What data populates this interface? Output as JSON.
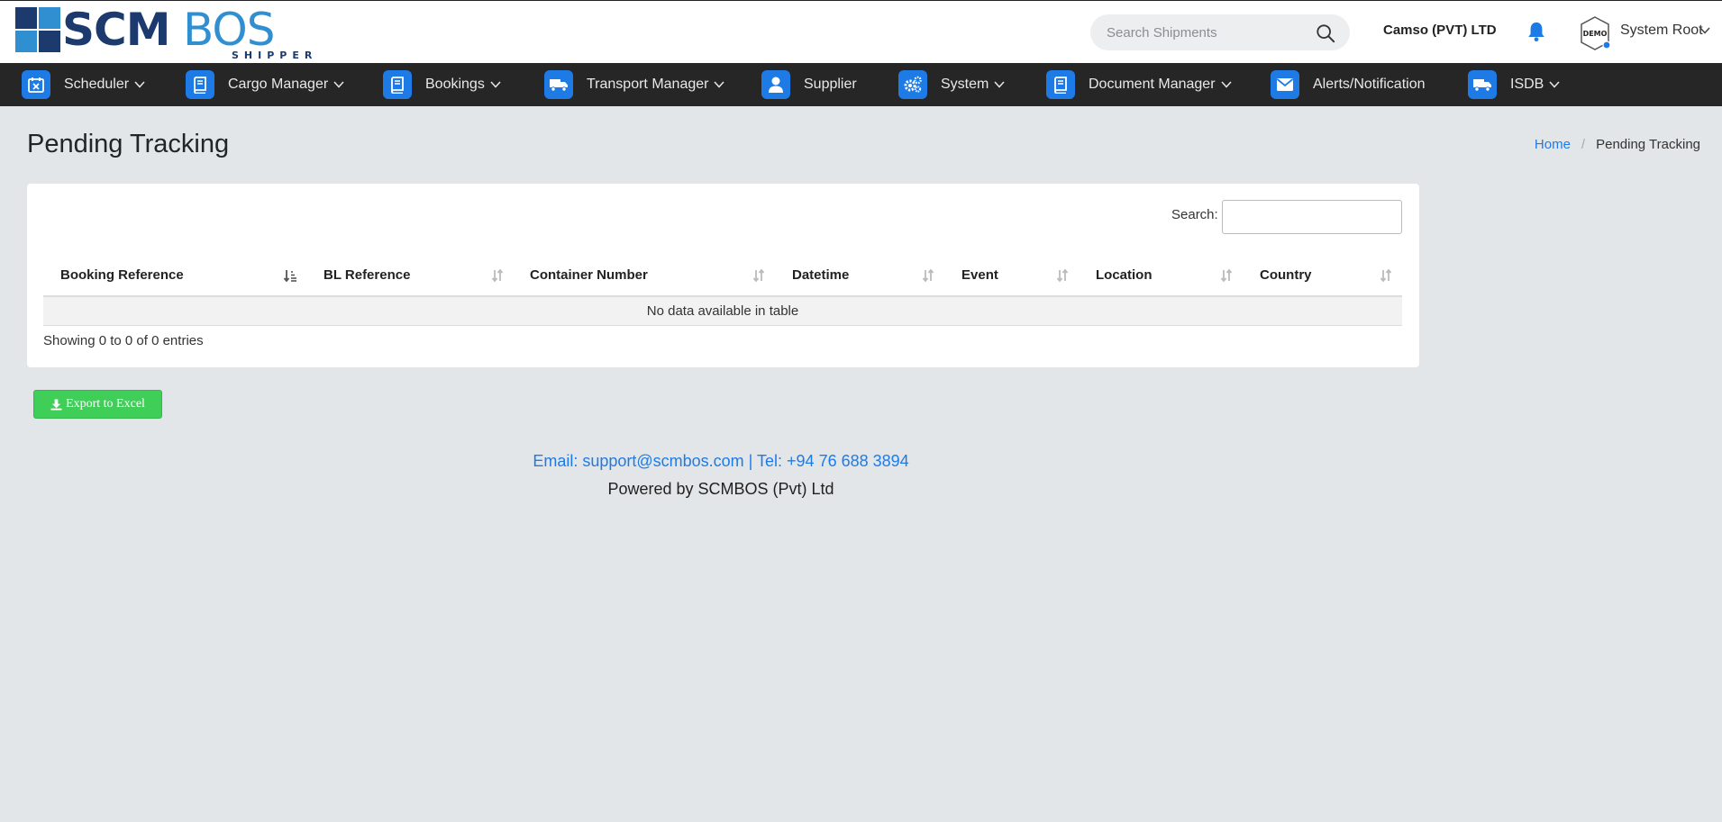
{
  "header": {
    "logo": {
      "main": "SCM",
      "accent": "BOS",
      "sub": "SHIPPER"
    },
    "search": {
      "placeholder": "Search Shipments",
      "value": ""
    },
    "company": "Camso (PVT) LTD",
    "user": {
      "name": "System Root",
      "avatar_label": "DEMO"
    }
  },
  "nav": {
    "items": [
      {
        "label": "Scheduler",
        "icon": "calendar-x-icon",
        "dropdown": true
      },
      {
        "label": "Cargo Manager",
        "icon": "book-icon",
        "dropdown": true
      },
      {
        "label": "Bookings",
        "icon": "book-icon",
        "dropdown": true
      },
      {
        "label": "Transport Manager",
        "icon": "truck-icon",
        "dropdown": true
      },
      {
        "label": "Supplier",
        "icon": "user-icon",
        "dropdown": false
      },
      {
        "label": "System",
        "icon": "gears-icon",
        "dropdown": true
      },
      {
        "label": "Document Manager",
        "icon": "book-icon",
        "dropdown": true
      },
      {
        "label": "Alerts/Notification",
        "icon": "envelope-icon",
        "dropdown": false
      },
      {
        "label": "ISDB",
        "icon": "truck-icon",
        "dropdown": true
      }
    ]
  },
  "page": {
    "title": "Pending Tracking",
    "breadcrumb": {
      "home": "Home",
      "separator": "/",
      "current": "Pending Tracking"
    }
  },
  "table": {
    "search_label": "Search:",
    "search_value": "",
    "columns": [
      "Booking Reference",
      "BL Reference",
      "Container Number",
      "Datetime",
      "Event",
      "Location",
      "Country"
    ],
    "empty_message": "No data available in table",
    "info": "Showing 0 to 0 of 0 entries"
  },
  "actions": {
    "export_label": "Export to Excel"
  },
  "footer": {
    "contact": "Email: support@scmbos.com | Tel: +94 76 688 3894",
    "powered": "Powered by SCMBOS (Pvt) Ltd"
  },
  "colors": {
    "accent": "#1e7be6",
    "nav_bg": "#262626",
    "page_bg": "#e3e6e8",
    "export_btn": "#3fcf59"
  }
}
